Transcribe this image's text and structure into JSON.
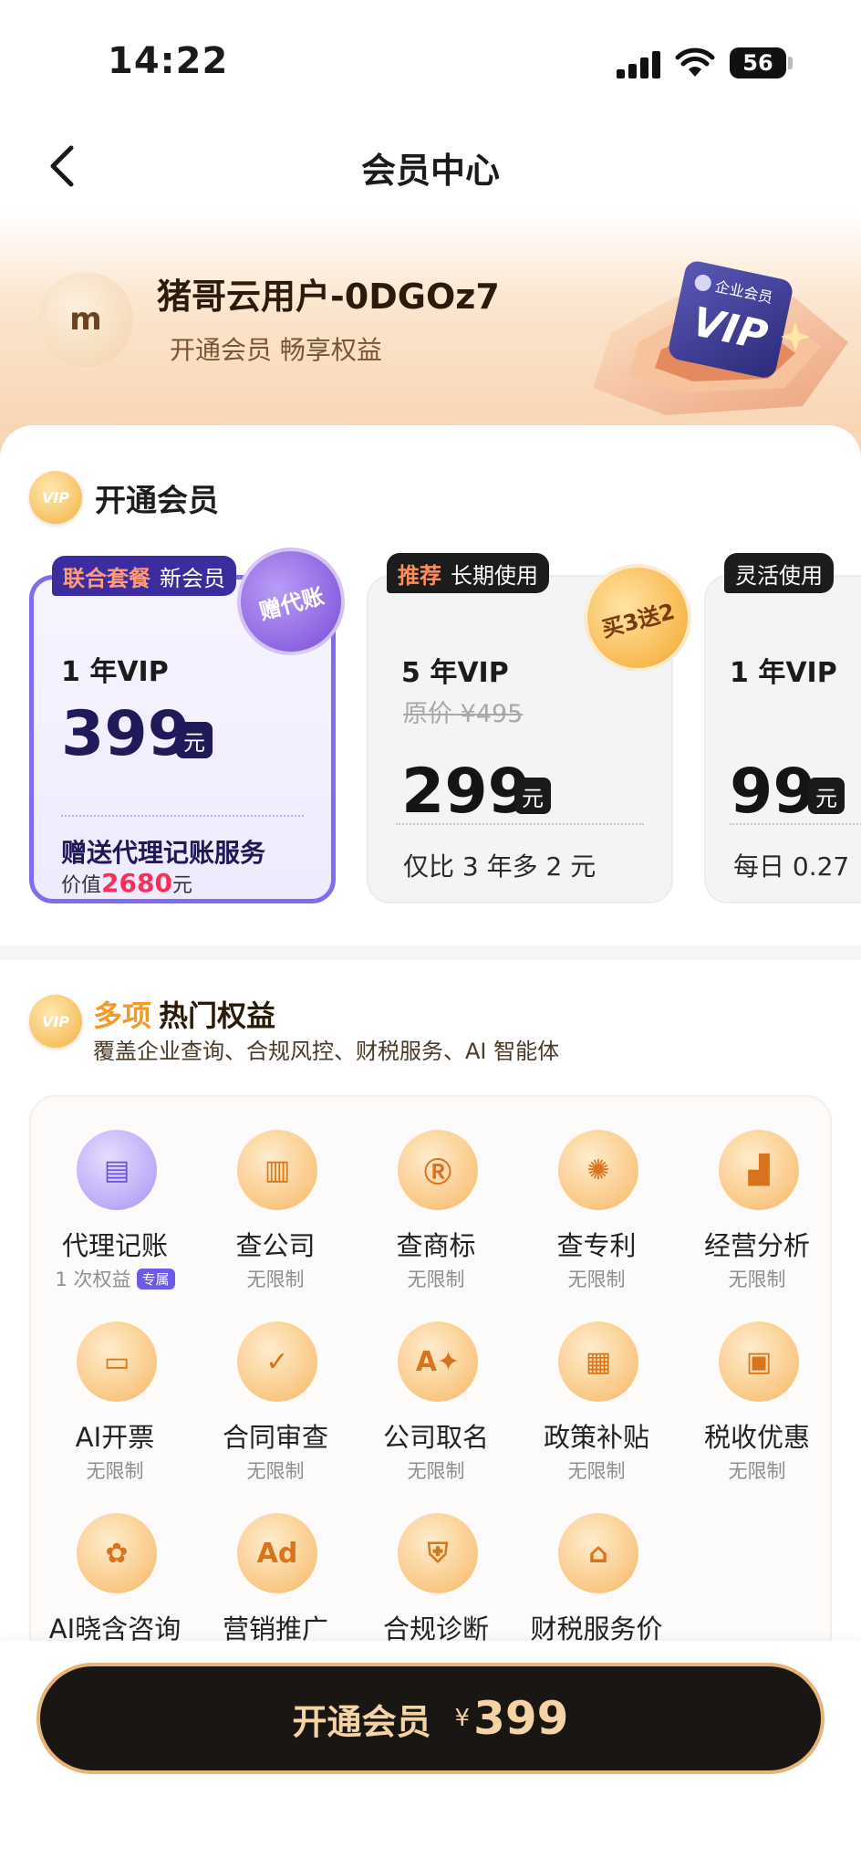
{
  "status_bar": {
    "time": "14:22",
    "battery": "56"
  },
  "nav": {
    "title": "会员中心"
  },
  "user": {
    "avatar_letter": "m",
    "name": "猪哥云用户-0DGOz7",
    "subtitle": "开通会员 畅享权益",
    "illustration_badge": "企业会员",
    "illustration_text": "VIP"
  },
  "open_section": {
    "badge": "VIP",
    "title": "开通会员"
  },
  "plans": [
    {
      "tag_highlight": "联合套餐",
      "tag_text": "新会员",
      "name": "1 年VIP",
      "price": "399",
      "yuan": "元",
      "gift_title": "赠送代理记账服务",
      "gift_prefix": "价值",
      "gift_value": "2680",
      "gift_suffix": "元",
      "stamp": "赠代账",
      "selected": true
    },
    {
      "tag_highlight": "推荐",
      "tag_text": "长期使用",
      "name": "5 年VIP",
      "original_price": "原价 ¥495",
      "price": "299",
      "yuan": "元",
      "footer": "仅比 3 年多 2 元",
      "stamp": "买3送2",
      "selected": false
    },
    {
      "tag_highlight": "",
      "tag_text": "灵活使用",
      "name": "1 年VIP",
      "price": "99",
      "yuan": "元",
      "footer": "每日 0.27",
      "selected": false
    }
  ],
  "benefits": {
    "badge": "VIP",
    "title_accent": "多项",
    "title": "热门权益",
    "subtitle": "覆盖企业查询、合规风控、财税服务、AI 智能体",
    "items": [
      {
        "name": "代理记账",
        "note": "1 次权益",
        "tag": "专属",
        "icon": "ledger-icon",
        "glyph": "▤",
        "style": "purple"
      },
      {
        "name": "查公司",
        "note": "无限制",
        "icon": "building-icon",
        "glyph": "▥"
      },
      {
        "name": "查商标",
        "note": "无限制",
        "icon": "trademark-icon",
        "glyph": "Ⓡ"
      },
      {
        "name": "查专利",
        "note": "无限制",
        "icon": "lightbulb-icon",
        "glyph": "✺"
      },
      {
        "name": "经营分析",
        "note": "无限制",
        "icon": "bar-chart-icon",
        "glyph": "▟"
      },
      {
        "name": "AI开票",
        "note": "无限制",
        "icon": "invoice-icon",
        "glyph": "▭"
      },
      {
        "name": "合同审查",
        "note": "无限制",
        "icon": "contract-check-icon",
        "glyph": "✓"
      },
      {
        "name": "公司取名",
        "note": "无限制",
        "icon": "ai-naming-icon",
        "glyph": "A✦"
      },
      {
        "name": "政策补贴",
        "note": "无限制",
        "icon": "government-icon",
        "glyph": "▦"
      },
      {
        "name": "税收优惠",
        "note": "无限制",
        "icon": "tax-coupon-icon",
        "glyph": "▣"
      },
      {
        "name": "AI晓含咨询",
        "note": "",
        "icon": "ai-consult-icon",
        "glyph": "✿"
      },
      {
        "name": "营销推广",
        "note": "",
        "icon": "ad-icon",
        "glyph": "Ad"
      },
      {
        "name": "合规诊断",
        "note": "",
        "icon": "shield-check-icon",
        "glyph": "⛨"
      },
      {
        "name": "财税服务价",
        "note": "",
        "icon": "basket-icon",
        "glyph": "⌂"
      }
    ]
  },
  "cta": {
    "label": "开通会员",
    "currency": "¥",
    "price": "399"
  },
  "colors": {
    "accent_purple": "#7f6cf0",
    "cta_bg": "#1a1614",
    "cta_text": "#f6d3a4",
    "gold": "#f09a28"
  }
}
